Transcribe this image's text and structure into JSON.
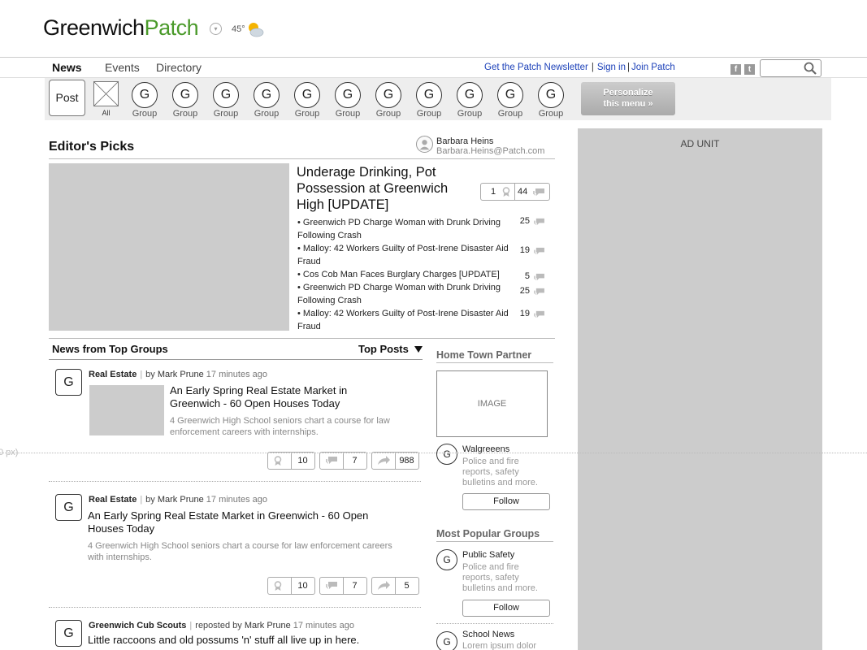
{
  "header": {
    "logo_part1": "Greenwich",
    "logo_part2": "Patch",
    "logo_caret": "▾",
    "temperature": "45°",
    "weather_icon": "partly-cloudy-icon"
  },
  "nav": {
    "news": "News",
    "events": "Events",
    "directory": "Directory",
    "newsletter": "Get the Patch Newsletter",
    "sep1": "|",
    "sign_in": "Sign in",
    "sep2": "|",
    "join": "Join Patch",
    "facebook": "f",
    "twitter": "t",
    "search_placeholder": ""
  },
  "groups": {
    "post_label": "Post",
    "all_label": "All",
    "items": [
      {
        "letter": "G",
        "label": "Group"
      },
      {
        "letter": "G",
        "label": "Group"
      },
      {
        "letter": "G",
        "label": "Group"
      },
      {
        "letter": "G",
        "label": "Group"
      },
      {
        "letter": "G",
        "label": "Group"
      },
      {
        "letter": "G",
        "label": "Group"
      },
      {
        "letter": "G",
        "label": "Group"
      },
      {
        "letter": "G",
        "label": "Group"
      },
      {
        "letter": "G",
        "label": "Group"
      },
      {
        "letter": "G",
        "label": "Group"
      },
      {
        "letter": "G",
        "label": "Group"
      }
    ],
    "personalize_line1": "Personalize",
    "personalize_line2": "this menu »"
  },
  "ad": {
    "label": "AD UNIT"
  },
  "editors_picks": {
    "title": "Editor's Picks",
    "author_name": "Barbara Heins",
    "author_email": "Barbara.Heins@Patch.com",
    "headline": "Underage Drinking, Pot Possession at Greenwich High [UPDATE]",
    "award_count": "1",
    "comment_count": "44",
    "items": [
      {
        "text": "• Greenwich PD Charge Woman with Drunk Driving Following Crash",
        "count": "25"
      },
      {
        "text": "• Malloy: 42 Workers Guilty of Post-Irene Disaster Aid Fraud",
        "count": "19"
      },
      {
        "text": "• Cos Cob Man Faces Burglary Charges [UPDATE]",
        "count": "5"
      },
      {
        "text": "• Greenwich PD Charge Woman with Drunk Driving Following Crash",
        "count": "25"
      },
      {
        "text": "• Malloy: 42 Workers Guilty of Post-Irene Disaster Aid Fraud",
        "count": "19"
      }
    ]
  },
  "news_top_groups": {
    "title": "News from Top Groups",
    "sort_label": "Top Posts",
    "posts": [
      {
        "letter": "G",
        "group": "Real Estate",
        "by": "by",
        "author": "Mark Prune",
        "time": "17 minutes ago",
        "headline": "An Early Spring Real Estate Market in Greenwich - 60 Open Houses Today",
        "desc": "4 Greenwich High School seniors chart a course for law enforcement careers with internships.",
        "awards": "10",
        "comments": "7",
        "shares": "988"
      },
      {
        "letter": "G",
        "group": "Real Estate",
        "by": "by",
        "author": "Mark Prune",
        "time": "17 minutes ago",
        "headline": "An Early Spring Real Estate Market in Greenwich - 60 Open Houses Today",
        "desc": "4 Greenwich High School seniors chart a course for law enforcement careers with internships.",
        "awards": "10",
        "comments": "7",
        "shares": "5"
      },
      {
        "letter": "G",
        "group": "Greenwich Cub Scouts",
        "by": "reposted by",
        "author": "Mark Prune",
        "time": "17 minutes ago",
        "headline": "Little raccoons and old possums 'n' stuff all live up in here."
      }
    ]
  },
  "sidebar": {
    "htp_title": "Home Town Partner",
    "htp_image": "IMAGE",
    "htp_partner": {
      "letter": "G",
      "name": "Walgreeens",
      "desc": "Police and fire reports, safety bulletins and more.",
      "follow": "Follow"
    },
    "mpg_title": "Most Popular Groups",
    "mpg_items": [
      {
        "letter": "G",
        "name": "Public Safety",
        "desc": "Police and fire reports, safety bulletins and more.",
        "follow": "Follow"
      },
      {
        "letter": "G",
        "name": "School News",
        "desc": "Lorem ipsum dolor"
      }
    ]
  },
  "guide": {
    "label": "0 px)"
  }
}
